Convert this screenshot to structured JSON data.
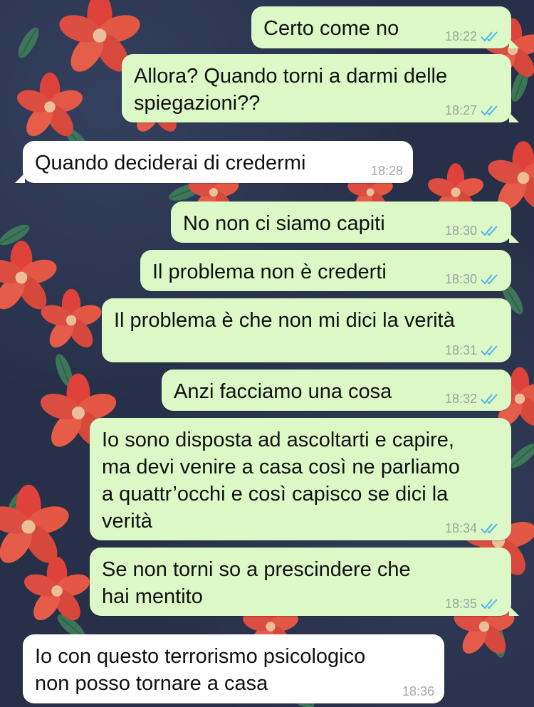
{
  "theme": {
    "outgoing_bubble": "#dcf8c6",
    "incoming_bubble": "#ffffff",
    "read_tick_color": "#4fb6ec",
    "wallpaper": "dark navy with red flowers"
  },
  "messages": [
    {
      "direction": "out",
      "text": "Certo come no",
      "time": "18:22",
      "status": "read-double-tick-icon"
    },
    {
      "direction": "out",
      "text": "Allora? Quando torni a darmi delle\nspiegazioni??",
      "time": "18:27",
      "status": "read-double-tick-icon"
    },
    {
      "direction": "in",
      "text": "Quando deciderai di credermi",
      "time": "18:28"
    },
    {
      "direction": "out",
      "text": "No non ci siamo capiti",
      "time": "18:30",
      "status": "read-double-tick-icon"
    },
    {
      "direction": "out",
      "text": "Il problema non è crederti",
      "time": "18:30",
      "status": "read-double-tick-icon"
    },
    {
      "direction": "out",
      "text": "Il problema è che non mi dici la verità",
      "time": "18:31",
      "status": "read-double-tick-icon"
    },
    {
      "direction": "out",
      "text": "Anzi facciamo una cosa",
      "time": "18:32",
      "status": "read-double-tick-icon"
    },
    {
      "direction": "out",
      "text": "Io sono disposta ad ascoltarti e capire,\nma devi venire a casa così ne parliamo\na quattr’occhi e così capisco se dici la\nverità",
      "time": "18:34",
      "status": "read-double-tick-icon"
    },
    {
      "direction": "out",
      "text": "Se non torni so a prescindere che\nhai mentito",
      "time": "18:35",
      "status": "read-double-tick-icon"
    },
    {
      "direction": "in",
      "text": "Io con questo terrorismo psicologico\nnon posso tornare a casa",
      "time": "18:36"
    }
  ]
}
